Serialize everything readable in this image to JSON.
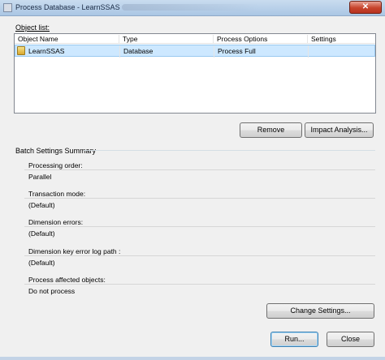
{
  "window": {
    "title": "Process Database - LearnSSAS",
    "close_glyph": "✕",
    "icon": "window-app-icon"
  },
  "object_list": {
    "label": "Object list:",
    "columns": [
      "Object Name",
      "Type",
      "Process Options",
      "Settings"
    ],
    "rows": [
      {
        "name": "LearnSSAS",
        "type": "Database",
        "process_option": "Process Full",
        "settings": "",
        "icon": "database-folder-icon"
      }
    ]
  },
  "buttons": {
    "remove": "Remove",
    "impact_analysis": "Impact Analysis...",
    "change_settings": "Change Settings...",
    "run": "Run...",
    "close": "Close"
  },
  "batch_settings": {
    "title": "Batch Settings Summary",
    "items": [
      {
        "label": "Processing order:",
        "value": "Parallel"
      },
      {
        "label": "Transaction mode:",
        "value": "(Default)"
      },
      {
        "label": "Dimension errors:",
        "value": "(Default)"
      },
      {
        "label": "Dimension key error log path :",
        "value": "(Default)"
      },
      {
        "label": "Process affected objects:",
        "value": "Do not process"
      }
    ]
  },
  "colors": {
    "selection": "#cde8ff",
    "titlebar": "#aac6e4",
    "close_button": "#c7442c"
  }
}
